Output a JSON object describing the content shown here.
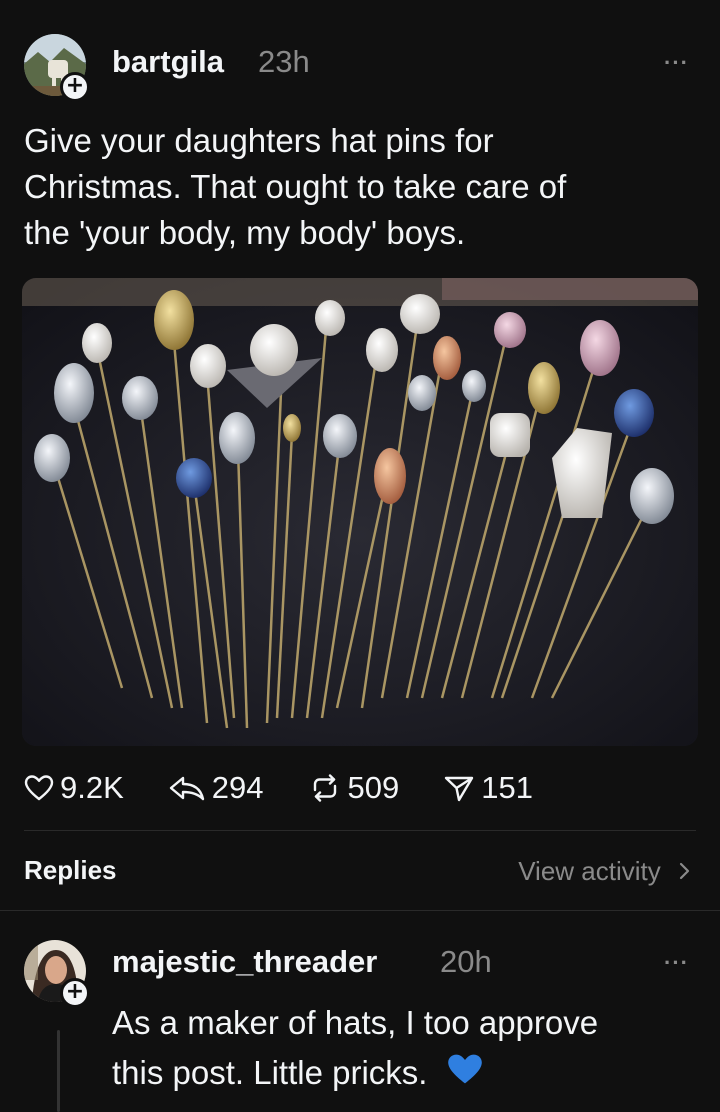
{
  "post": {
    "username": "bartgila",
    "time": "23h",
    "more_label": "···",
    "text_lines": [
      "Give your daughters hat pins for",
      "Christmas. That ought to take care of",
      "the 'your body, my body' boys."
    ],
    "image_alt": "Hat pins",
    "stats": {
      "likes": "9.2K",
      "replies": "294",
      "reposts": "509",
      "shares": "151"
    }
  },
  "replies_section": {
    "title": "Replies",
    "view_activity": "View activity"
  },
  "reply": {
    "username": "majestic_threader",
    "time": "20h",
    "more_label": "···",
    "text_lines": [
      "As a maker of hats, I too approve",
      "this post. Little pricks."
    ],
    "emoji": "💙"
  },
  "colors": {
    "background": "#101010",
    "text": "#f3f5f7",
    "muted": "#8a8a8a",
    "heart_emoji": "#2f7fe0"
  }
}
